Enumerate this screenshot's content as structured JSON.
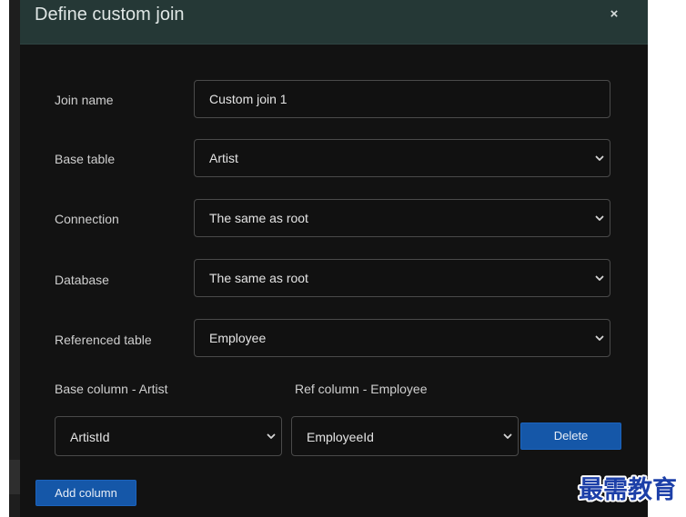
{
  "dialog": {
    "title": "Define custom join",
    "close_glyph": "×"
  },
  "form": {
    "join_name": {
      "label": "Join name",
      "value": "Custom join 1"
    },
    "base_table": {
      "label": "Base table",
      "value": "Artist"
    },
    "connection": {
      "label": "Connection",
      "value": "The same as root"
    },
    "database": {
      "label": "Database",
      "value": "The same as root"
    },
    "referenced_table": {
      "label": "Referenced table",
      "value": "Employee"
    }
  },
  "columns": {
    "base_label": "Base column - Artist",
    "ref_label": "Ref column - Employee",
    "base_value": "ArtistId",
    "ref_value": "EmployeeId",
    "delete_label": "Delete",
    "add_label": "Add column"
  },
  "watermark": {
    "text": "最需教育"
  },
  "icons": {
    "close": "close-icon",
    "dropdown": "chevron-down-icon"
  },
  "colors": {
    "header_bg": "#253836",
    "dialog_bg": "#121212",
    "button_blue": "#1557a8",
    "watermark_blue": "#1c3fa8"
  }
}
